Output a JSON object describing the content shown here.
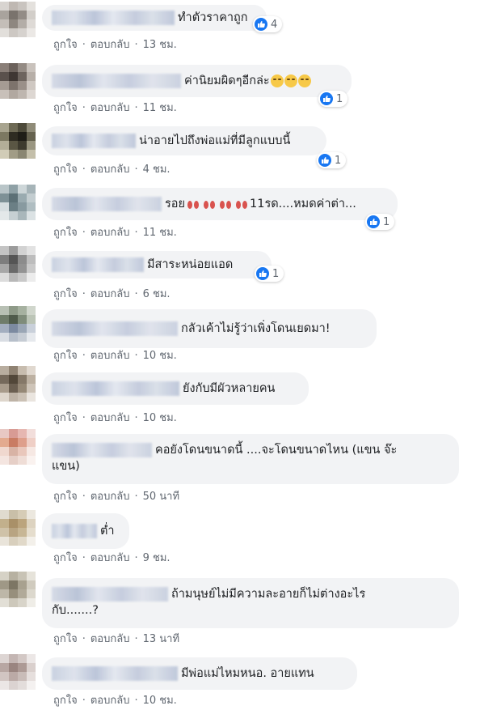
{
  "actions": {
    "like": "ถูกใจ",
    "reply": "ตอบกลับ",
    "separator": "·"
  },
  "comments": [
    {
      "text": "ทำตัวราคาถูก",
      "time": "13 ชม.",
      "reactions": "4"
    },
    {
      "text": "ค่านิยมผิดๆอีกล่ะ",
      "time": "11 ชม.",
      "reactions": "1"
    },
    {
      "text": "น่าอายไปถึงพ่อแม่ที่มีลูกแบบนี้",
      "time": "4 ชม.",
      "reactions": "1"
    },
    {
      "text_before": "รอย",
      "text_after": "11รด....หมดค่าต่า...",
      "time": "11 ชม.",
      "reactions": "1"
    },
    {
      "text": "มีสาระหน่อยแอด",
      "time": "6 ชม.",
      "reactions": "1"
    },
    {
      "text": "กลัวเค้าไม่รู้ว่าเพิ่งโดนเยดมา!",
      "time": "10 ชม."
    },
    {
      "text": "ยังกับมีผัวหลายคน",
      "time": "10 ชม."
    },
    {
      "line1": "คอยังโดนขนาดนี้ ....จะโดนขนาดไหน (แขน จ๊ะ",
      "line2": "แขน)",
      "time": "50 นาที"
    },
    {
      "text": "ต่ำ",
      "time": "9 ชม."
    },
    {
      "line1": "ถ้ามนุษย์ไม่มีความละอายก็ไม่ต่างอะไร",
      "line2": "กับ.......?",
      "time": "13 นาที"
    },
    {
      "text": "มีพ่อแม่ไหมหนอ. อายแทน",
      "time": "10 ชม."
    }
  ]
}
